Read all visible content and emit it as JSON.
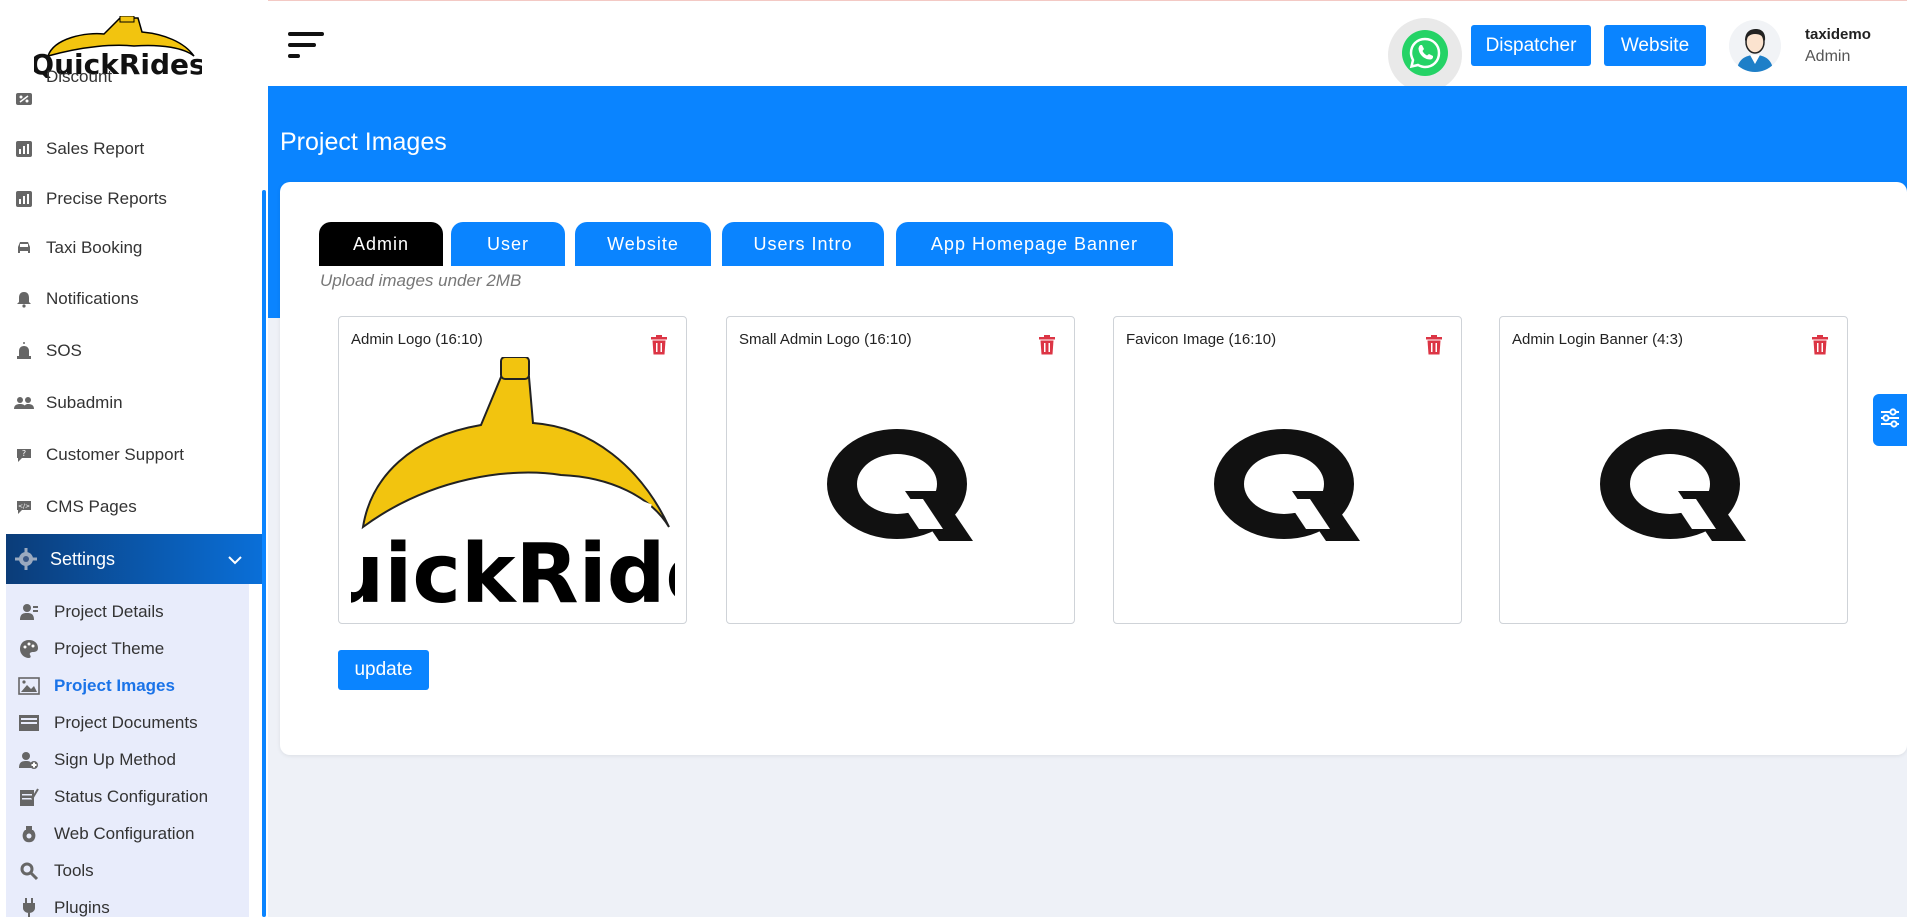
{
  "brand": {
    "logo_text": "QuickRides"
  },
  "sidebar": {
    "items": [
      {
        "label": "Discount",
        "icon": "discount-icon"
      },
      {
        "label": "Sales Report",
        "icon": "chart-icon"
      },
      {
        "label": "Precise Reports",
        "icon": "chart-icon"
      },
      {
        "label": "Taxi Booking",
        "icon": "car-icon"
      },
      {
        "label": "Notifications",
        "icon": "bell-icon"
      },
      {
        "label": "SOS",
        "icon": "alarm-icon"
      },
      {
        "label": "Subadmin",
        "icon": "users-icon"
      },
      {
        "label": "Customer Support",
        "icon": "chat-icon"
      },
      {
        "label": "CMS Pages",
        "icon": "code-icon"
      }
    ],
    "settings": {
      "label": "Settings",
      "icon": "gear-icon"
    },
    "submenu": [
      {
        "label": "Project Details",
        "icon": "user-details-icon"
      },
      {
        "label": "Project Theme",
        "icon": "palette-icon"
      },
      {
        "label": "Project Images",
        "icon": "image-icon",
        "active": true
      },
      {
        "label": "Project Documents",
        "icon": "folder-icon"
      },
      {
        "label": "Sign Up Method",
        "icon": "user-plus-icon"
      },
      {
        "label": "Status Configuration",
        "icon": "status-icon"
      },
      {
        "label": "Web Configuration",
        "icon": "web-icon"
      },
      {
        "label": "Tools",
        "icon": "tools-icon"
      },
      {
        "label": "Plugins",
        "icon": "plug-icon"
      }
    ]
  },
  "header": {
    "dispatcher_label": "Dispatcher",
    "website_label": "Website",
    "user_name": "taxidemo",
    "user_role": "Admin"
  },
  "page": {
    "title": "Project Images",
    "tabs": [
      "Admin",
      "User",
      "Website",
      "Users Intro",
      "App Homepage Banner"
    ],
    "active_tab": "Admin",
    "hint": "Upload images under 2MB",
    "images": [
      {
        "label": "Admin Logo (16:10)"
      },
      {
        "label": "Small Admin Logo (16:10)"
      },
      {
        "label": "Favicon Image (16:10)"
      },
      {
        "label": "Admin Login Banner (4:3)"
      }
    ],
    "update_label": "update"
  },
  "colors": {
    "accent": "#0a84ff",
    "danger": "#dc3545",
    "logo_yellow": "#f2c40f"
  }
}
